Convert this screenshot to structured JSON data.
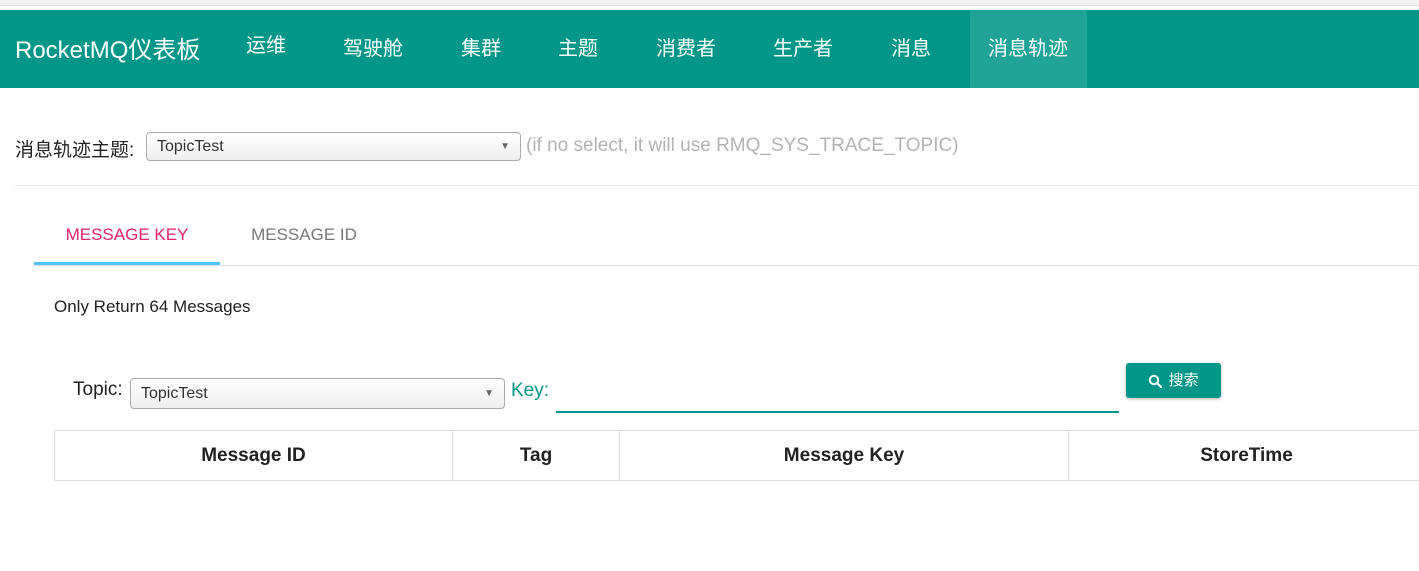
{
  "navbar": {
    "brand": "RocketMQ仪表板",
    "items": [
      {
        "label": "运维"
      },
      {
        "label": "驾驶舱"
      },
      {
        "label": "集群"
      },
      {
        "label": "主题"
      },
      {
        "label": "消费者"
      },
      {
        "label": "生产者"
      },
      {
        "label": "消息"
      },
      {
        "label": "消息轨迹"
      }
    ],
    "active_item": "消息轨迹",
    "color": "#009688"
  },
  "trace_topic": {
    "label": "消息轨迹主题:",
    "selected": "TopicTest",
    "hint": "(if no select, it will use RMQ_SYS_TRACE_TOPIC)"
  },
  "tabs": [
    {
      "label": "MESSAGE KEY",
      "active": true
    },
    {
      "label": "MESSAGE ID",
      "active": false
    }
  ],
  "note": "Only Return 64 Messages",
  "search": {
    "topic_label": "Topic:",
    "topic_selected": "TopicTest",
    "key_label": "Key:",
    "key_value": "",
    "button_label": "搜索",
    "button_icon": "search-icon"
  },
  "table": {
    "columns": [
      "Message ID",
      "Tag",
      "Message Key",
      "StoreTime"
    ],
    "rows": []
  },
  "colors": {
    "accent": "#009688",
    "tab_active_text": "#e2236c",
    "tab_underline": "#4fc3f7",
    "hint_text": "#b3b3b3"
  }
}
